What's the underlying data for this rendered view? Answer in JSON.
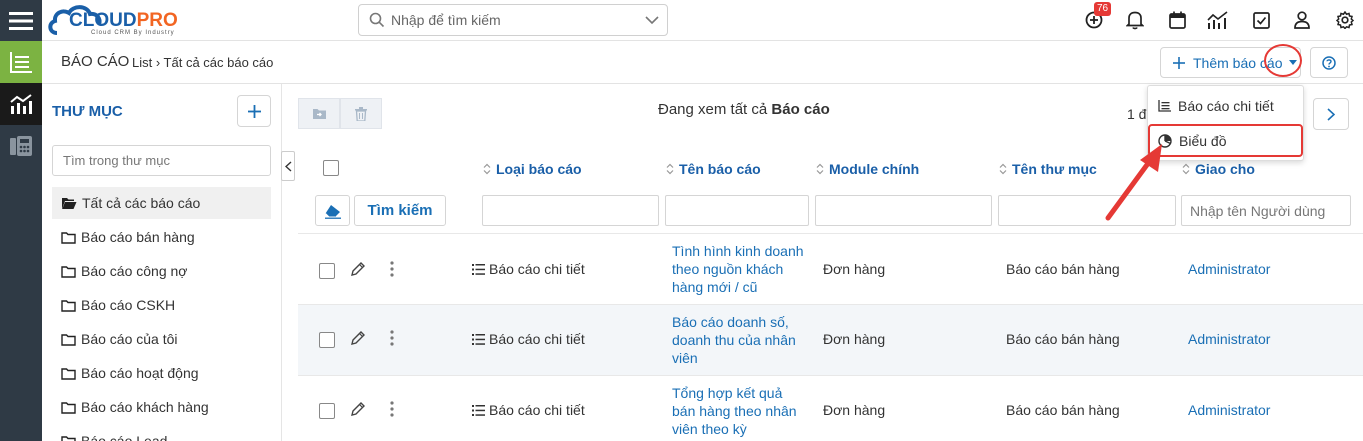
{
  "app": {
    "logo_text_cloud": "CLOUD",
    "logo_text_pro": "PRO",
    "logo_tagline": "Cloud CRM By Industry",
    "colors": {
      "logo_blue": "#1a5fa8",
      "logo_orange": "#f26522",
      "accent": "#1a6fb5",
      "rail": "#2f3a45",
      "rail_active": "#7cb342",
      "alert": "#e53935"
    }
  },
  "header": {
    "search_placeholder": "Nhập để tìm kiếm",
    "notification_count": "76",
    "icons": [
      "add-circle-icon",
      "bell-icon",
      "calendar-icon",
      "chart-icon",
      "checkbox-icon",
      "user-icon",
      "gear-icon"
    ]
  },
  "subheader": {
    "module_title": "BÁO CÁO",
    "breadcrumb": "List › Tất cả các báo cáo",
    "add_button": "Thêm báo cáo"
  },
  "dropdown": {
    "items": [
      {
        "label": "Báo cáo chi tiết",
        "icon": "list-report-icon"
      },
      {
        "label": "Biểu đồ",
        "icon": "pie-chart-icon"
      }
    ]
  },
  "folders": {
    "title": "THƯ MỤC",
    "search_placeholder": "Tìm trong thư mục",
    "items": [
      "Tất cả các báo cáo",
      "Báo cáo bán hàng",
      "Báo cáo công nợ",
      "Báo cáo CSKH",
      "Báo cáo của tôi",
      "Báo cáo hoạt động",
      "Báo cáo khách hàng",
      "Báo cáo Lead"
    ]
  },
  "main": {
    "viewing_prefix": "Đang xem tất cả",
    "viewing_module": "Báo cáo",
    "pager_text": "1 đ",
    "search_button": "Tìm kiếm",
    "columns": [
      "Loại báo cáo",
      "Tên báo cáo",
      "Module chính",
      "Tên thư mục",
      "Giao cho"
    ],
    "assignee_placeholder": "Nhập tên Người dùng",
    "rows": [
      {
        "type": "Báo cáo chi tiết",
        "name": "Tình hình kinh doanh theo nguồn khách hàng mới / cũ",
        "module": "Đơn hàng",
        "folder": "Báo cáo bán hàng",
        "assignee": "Administrator"
      },
      {
        "type": "Báo cáo chi tiết",
        "name": "Báo cáo doanh số, doanh thu của nhân viên",
        "module": "Đơn hàng",
        "folder": "Báo cáo bán hàng",
        "assignee": "Administrator"
      },
      {
        "type": "Báo cáo chi tiết",
        "name": "Tổng hợp kết quả bán hàng theo nhân viên theo kỳ",
        "module": "Đơn hàng",
        "folder": "Báo cáo bán hàng",
        "assignee": "Administrator"
      }
    ]
  }
}
